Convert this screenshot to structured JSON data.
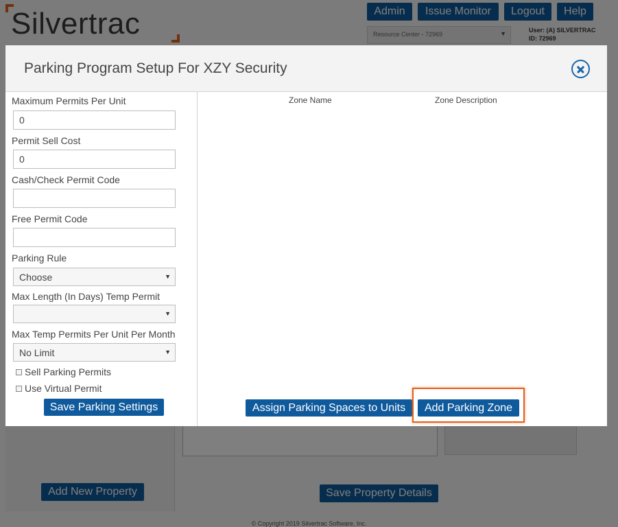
{
  "app": {
    "logo_text": "Silvertrac",
    "nav": [
      "Admin",
      "Issue Monitor",
      "Logout",
      "Help"
    ],
    "resource_center": "Resource Center - 72969",
    "user_line": "User: (A) SILVERTRAC",
    "id_line": "ID: 72969",
    "add_property_label": "Add New Property",
    "save_property_label": "Save Property Details",
    "copyright": "© Copyright 2019 Silvertrac Software, Inc."
  },
  "modal": {
    "title": "Parking Program Setup For XZY Security",
    "fields": {
      "max_permits": {
        "label": "Maximum Permits Per Unit",
        "value": "0"
      },
      "sell_cost": {
        "label": "Permit Sell Cost",
        "value": "0"
      },
      "cash_code": {
        "label": "Cash/Check Permit Code",
        "value": ""
      },
      "free_code": {
        "label": "Free Permit Code",
        "value": ""
      },
      "parking_rule": {
        "label": "Parking Rule",
        "value": "Choose"
      },
      "max_length": {
        "label": "Max Length (In Days) Temp Permit",
        "value": ""
      },
      "max_temp": {
        "label": "Max Temp Permits Per Unit Per Month",
        "value": "No Limit"
      }
    },
    "checkboxes": {
      "sell": {
        "label": "Sell Parking Permits",
        "checked": false
      },
      "virtual": {
        "label": "Use Virtual Permit",
        "checked": false
      }
    },
    "save_settings_label": "Save Parking Settings",
    "table": {
      "columns": [
        "Zone Name",
        "Zone Description"
      ],
      "rows": []
    },
    "assign_label": "Assign Parking Spaces to Units",
    "add_zone_label": "Add Parking Zone"
  },
  "colors": {
    "primary": "#0f5a9c",
    "accent": "#e2601c"
  }
}
